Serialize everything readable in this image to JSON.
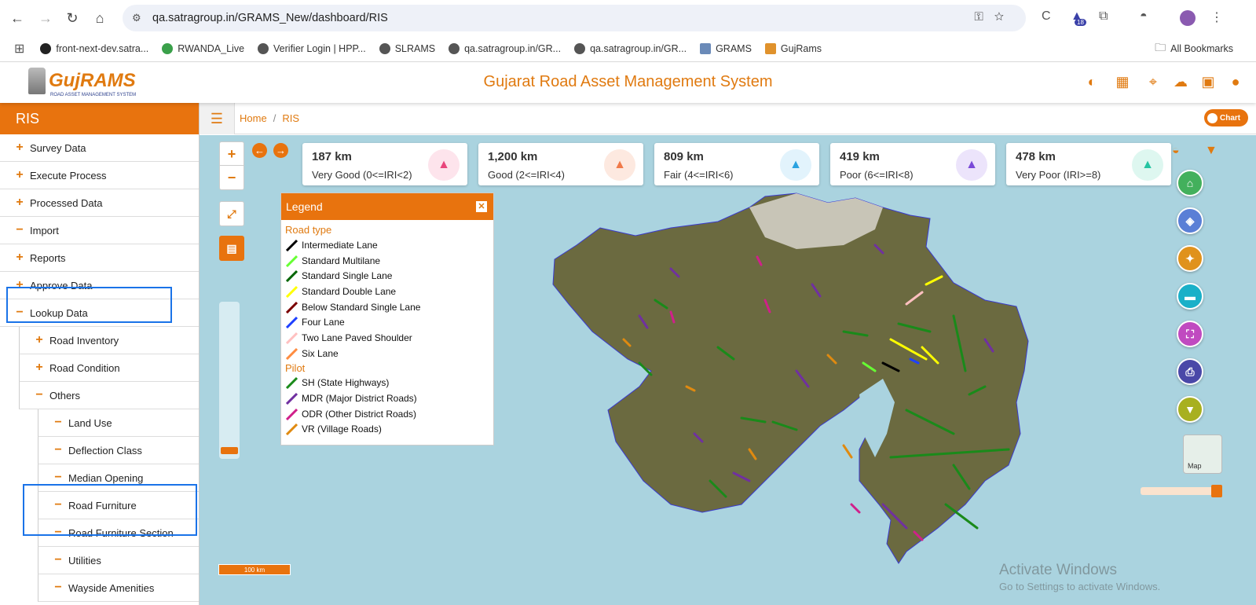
{
  "browser": {
    "url": "qa.satragroup.in/GRAMS_New/dashboard/RIS",
    "profile_badge": "18",
    "bookmarks": [
      {
        "label": "front-next-dev.satra...",
        "icon": "triangle-icon"
      },
      {
        "label": "RWANDA_Live",
        "icon": "globe-icon"
      },
      {
        "label": "Verifier Login | HPP...",
        "icon": "globe-icon"
      },
      {
        "label": "SLRAMS",
        "icon": "globe-icon"
      },
      {
        "label": "qa.satragroup.in/GR...",
        "icon": "globe-icon"
      },
      {
        "label": "qa.satragroup.in/GR...",
        "icon": "globe-icon"
      },
      {
        "label": "GRAMS",
        "icon": "doc-icon"
      },
      {
        "label": "GujRams",
        "icon": "chart-icon"
      }
    ],
    "all_bookmarks": "All Bookmarks"
  },
  "header": {
    "logo_text": "GujRAMS",
    "logo_sub": "ROAD ASSET MANAGEMENT SYSTEM",
    "title": "Gujarat Road Asset Management System"
  },
  "sidebar": {
    "title": "RIS",
    "items": [
      {
        "label": "Survey Data",
        "sym": "+"
      },
      {
        "label": "Execute Process",
        "sym": "+"
      },
      {
        "label": "Processed Data",
        "sym": "+"
      },
      {
        "label": "Import",
        "sym": "−"
      },
      {
        "label": "Reports",
        "sym": "+"
      },
      {
        "label": "Approve Data",
        "sym": "+"
      },
      {
        "label": "Lookup Data",
        "sym": "−"
      },
      {
        "label": "Road Inventory",
        "sym": "+"
      },
      {
        "label": "Road Condition",
        "sym": "+"
      },
      {
        "label": "Others",
        "sym": "−"
      },
      {
        "label": "Land Use",
        "sym": "−"
      },
      {
        "label": "Deflection Class",
        "sym": "−"
      },
      {
        "label": "Median Opening",
        "sym": "−"
      },
      {
        "label": "Road Furniture",
        "sym": "−"
      },
      {
        "label": "Road Furniture Section",
        "sym": "−"
      },
      {
        "label": "Utilities",
        "sym": "−"
      },
      {
        "label": "Wayside Amenities",
        "sym": "−"
      }
    ]
  },
  "breadcrumb": {
    "home": "Home",
    "current": "RIS",
    "chart_toggle": "Chart"
  },
  "cards": [
    {
      "value": "187 km",
      "label": "Very Good (0<=IRI<2)",
      "color": "#e8467c",
      "bg": "#fde4ec"
    },
    {
      "value": "1,200 km",
      "label": "Good (2<=IRI<4)",
      "color": "#f07a4a",
      "bg": "#fde9e0"
    },
    {
      "value": "809 km",
      "label": "Fair (4<=IRI<6)",
      "color": "#2aa2e0",
      "bg": "#e2f3fc"
    },
    {
      "value": "419 km",
      "label": "Poor (6<=IRI<8)",
      "color": "#7a4ad8",
      "bg": "#ece4fb"
    },
    {
      "value": "478 km",
      "label": "Very Poor (IRI>=8)",
      "color": "#25c4a2",
      "bg": "#def7f0"
    }
  ],
  "legend": {
    "title": "Legend",
    "road_type_title": "Road type",
    "road_types": [
      {
        "label": "Intermediate Lane",
        "color": "#000000"
      },
      {
        "label": "Standard Multilane",
        "color": "#66ff33"
      },
      {
        "label": "Standard Single Lane",
        "color": "#006400"
      },
      {
        "label": "Standard Double Lane",
        "color": "#ffff00"
      },
      {
        "label": "Below Standard Single Lane",
        "color": "#7a0000"
      },
      {
        "label": "Four Lane",
        "color": "#1e40ff"
      },
      {
        "label": "Two Lane Paved Shoulder",
        "color": "#ffc0c0"
      },
      {
        "label": "Six Lane",
        "color": "#ff8c40"
      }
    ],
    "pilot_title": "Pilot",
    "pilot": [
      {
        "label": "SH (State Highways)",
        "color": "#1a8a1a"
      },
      {
        "label": "MDR (Major District Roads)",
        "color": "#7030a0"
      },
      {
        "label": "ODR (Other District Roads)",
        "color": "#d0208a"
      },
      {
        "label": "VR (Village Roads)",
        "color": "#e08a10"
      }
    ]
  },
  "map": {
    "scale_label": "100 km",
    "basemap_label": "Map",
    "watermark_title": "Activate Windows",
    "watermark_sub": "Go to Settings to activate Windows."
  },
  "tools": [
    {
      "icon": "home-icon",
      "color": "#43b05c"
    },
    {
      "icon": "layers-icon",
      "color": "#5a7fd6"
    },
    {
      "icon": "poi-icon",
      "color": "#e0921c"
    },
    {
      "icon": "ruler-icon",
      "color": "#1ab0c8"
    },
    {
      "icon": "fullscreen-icon",
      "color": "#c04ac0"
    },
    {
      "icon": "print-icon",
      "color": "#4a48a8"
    },
    {
      "icon": "filter-icon",
      "color": "#a8b020"
    }
  ],
  "colors": {
    "accent": "#e8730e",
    "highlight": "#1a73e8"
  }
}
